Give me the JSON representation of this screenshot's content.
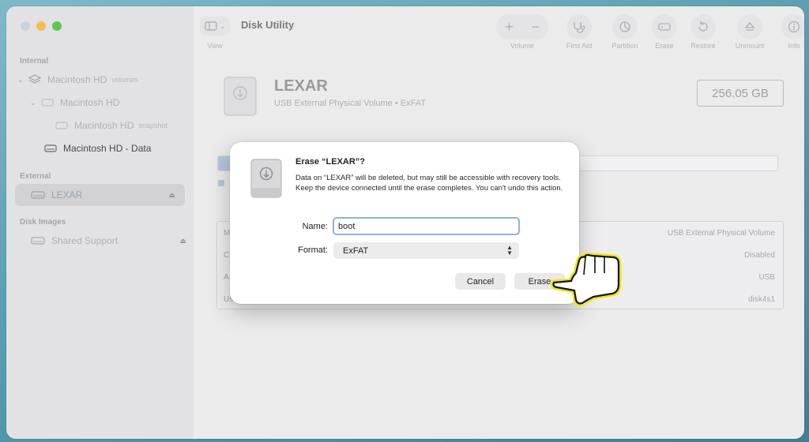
{
  "app": {
    "title": "Disk Utility"
  },
  "toolbar": {
    "view_label": "View",
    "plus": "+",
    "minus": "−",
    "volume_label": "Volume",
    "first_aid_label": "First Aid",
    "partition_label": "Partition",
    "erase_label": "Erase",
    "restore_label": "Restore",
    "unmount_label": "Unmount",
    "info_label": "Info"
  },
  "sidebar": {
    "internal_header": "Internal",
    "internal_items": [
      {
        "label": "Macintosh HD",
        "sub": "volumes"
      },
      {
        "label": "Macintosh HD",
        "sub": ""
      },
      {
        "label": "Macintosh HD",
        "sub": "snapshot"
      },
      {
        "label": "Macintosh HD - Data",
        "sub": ""
      }
    ],
    "external_header": "External",
    "external_items": [
      {
        "label": "LEXAR"
      }
    ],
    "disk_images_header": "Disk Images",
    "disk_image_items": [
      {
        "label": "Shared Support"
      }
    ]
  },
  "device": {
    "name": "LEXAR",
    "description": "USB External Physical Volume • ExFAT",
    "size": "256.05 GB",
    "usage_fraction": 0.04,
    "info_rows": [
      {
        "label_fragment": "M",
        "value": "USB External Physical Volume"
      },
      {
        "label_fragment": "C",
        "value": "Disabled"
      },
      {
        "label_fragment": "A",
        "value": "USB"
      },
      {
        "label_fragment": "Use",
        "value": "disk4s1"
      }
    ]
  },
  "dialog": {
    "title": "Erase “LEXAR”?",
    "message": "Data on “LEXAR” will be deleted, but may still be accessible with recovery tools. Keep the device connected until the erase completes. You can't undo this action.",
    "name_label": "Name:",
    "name_value": "boot",
    "format_label": "Format:",
    "format_value": "ExFAT",
    "cancel_label": "Cancel",
    "erase_label": "Erase"
  },
  "colors": {
    "accent": "#8fb1e5",
    "traffic_min": "#f3be4f",
    "traffic_max": "#5ec752",
    "pointer_fill": "#ffffff",
    "pointer_outline": "#f3e600"
  }
}
